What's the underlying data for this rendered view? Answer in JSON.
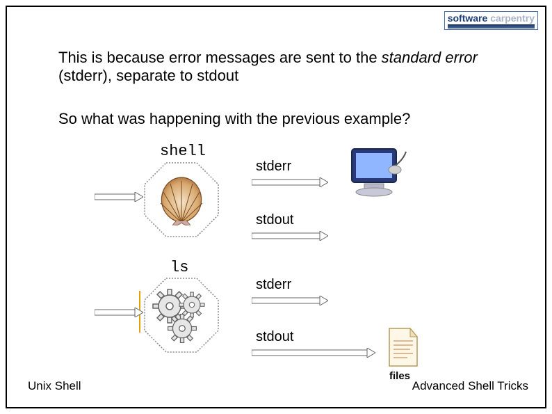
{
  "logo": {
    "left": "software",
    "right": "carpentry"
  },
  "para1_a": "This is because error messages are sent to the ",
  "para1_em": "standard error",
  "para1_b": " (stderr), separate to stdout",
  "para2": "So what was happening with the previous example?",
  "shell_label": "shell",
  "ls_label": "ls",
  "streams": {
    "s1": "stderr",
    "s2": "stdout",
    "s3": "stderr",
    "s4": "stdout"
  },
  "files_caption": "files",
  "footer_left": "Unix Shell",
  "footer_right": "Advanced Shell Tricks"
}
